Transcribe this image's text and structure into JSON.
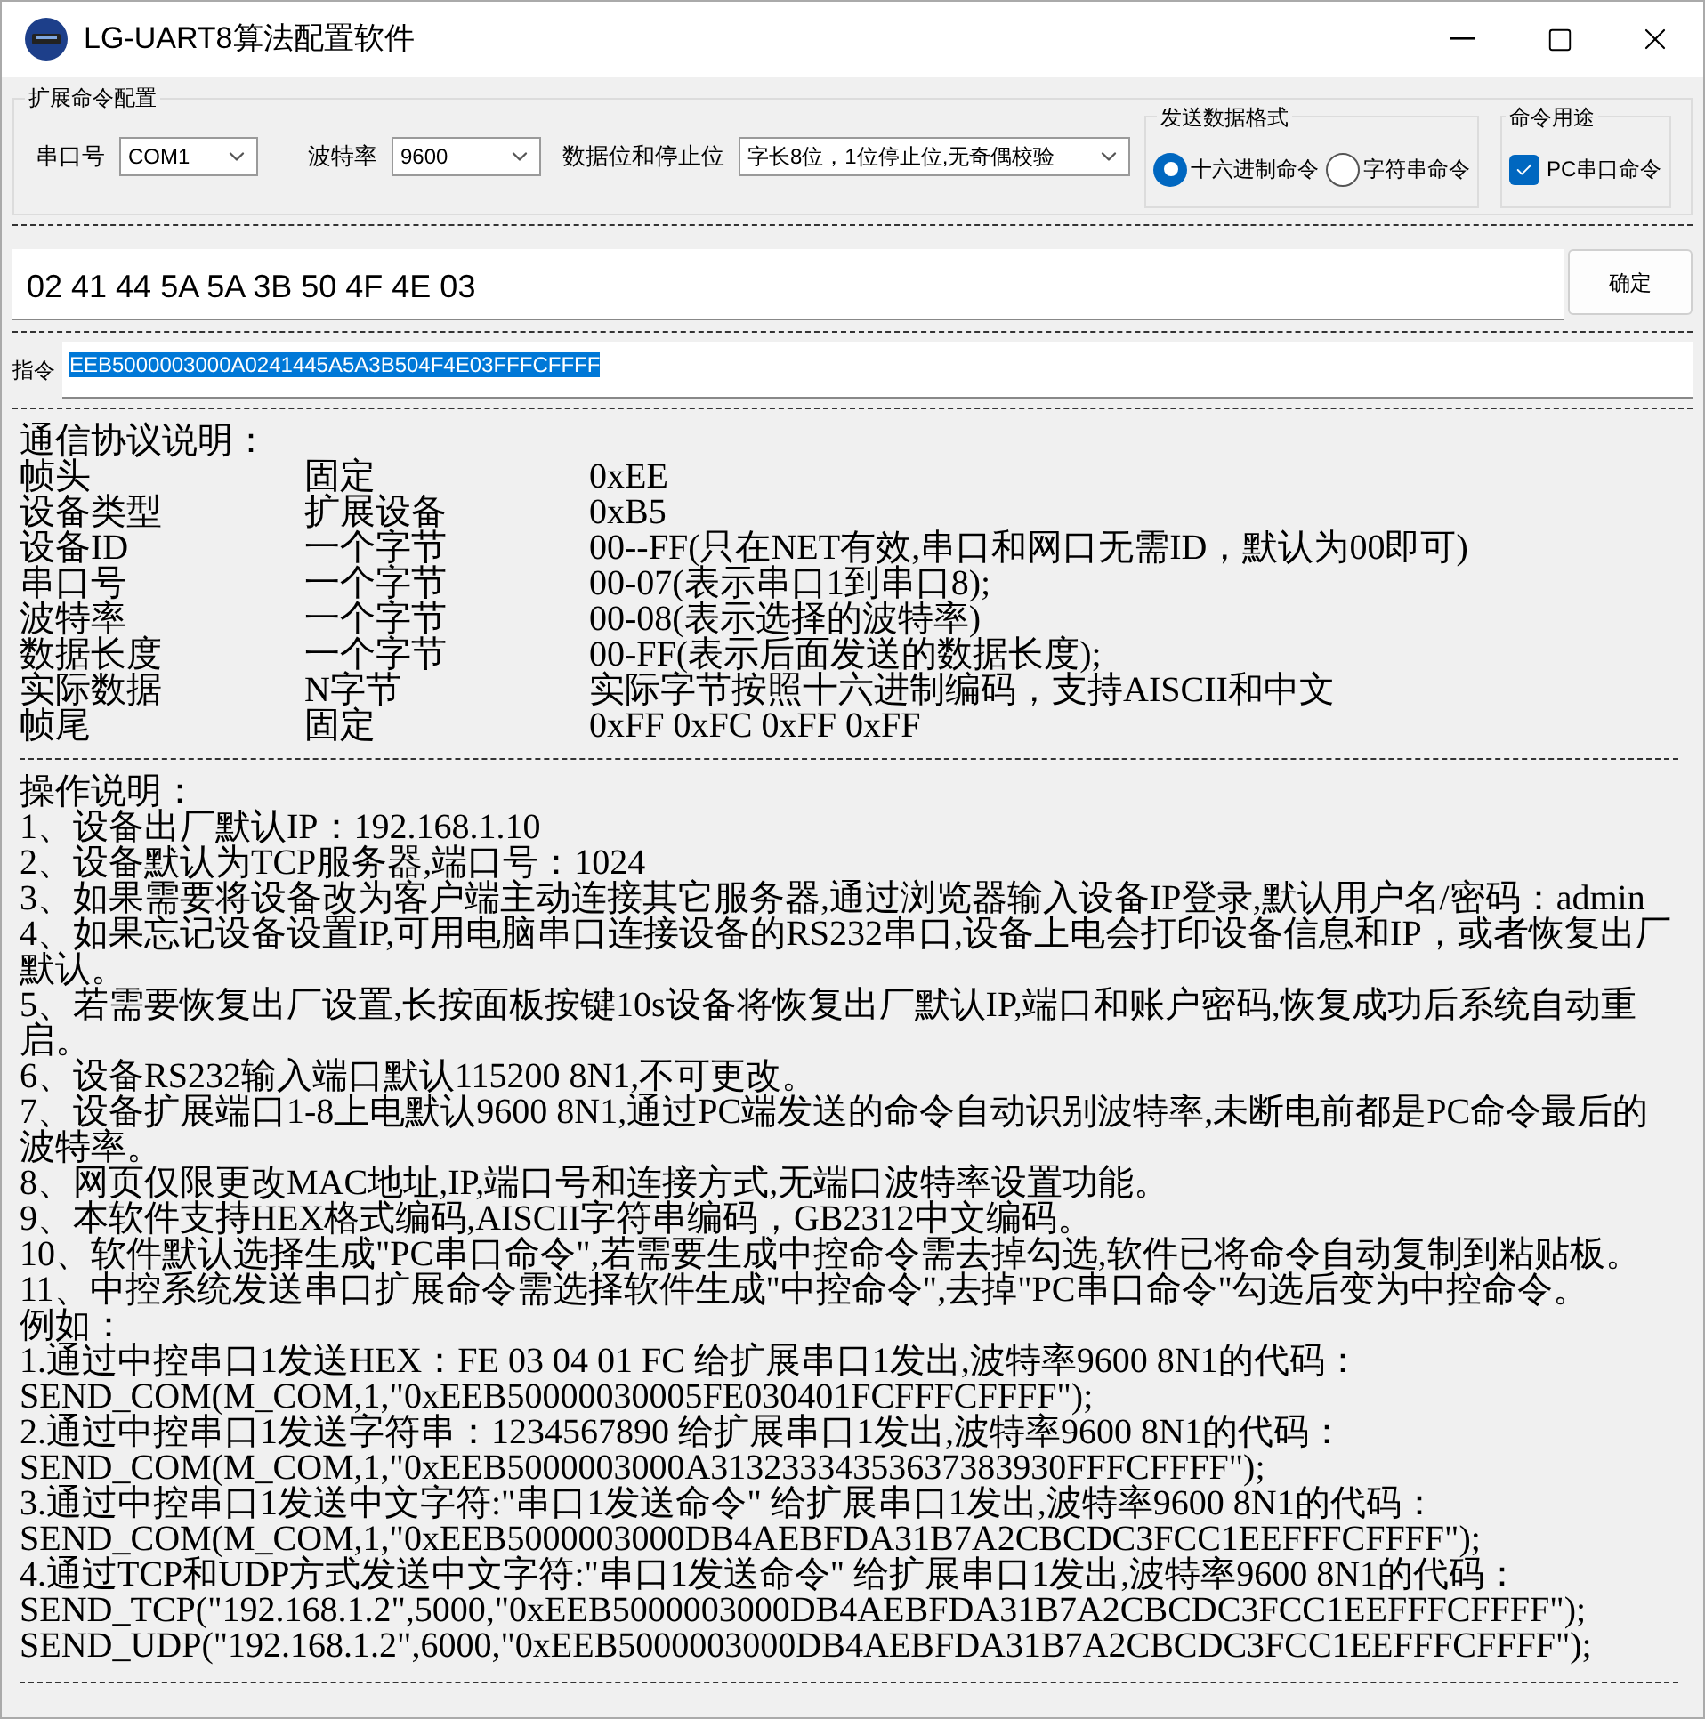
{
  "window": {
    "title": "LG-UART8算法配置软件"
  },
  "config": {
    "title": "扩展命令配置",
    "port": {
      "label": "串口号",
      "value": "COM1"
    },
    "baud": {
      "label": "波特率",
      "value": "9600"
    },
    "data_bits": {
      "label": "数据位和停止位",
      "value": "字长8位，1位停止位,无奇偶校验"
    },
    "format": {
      "title": "发送数据格式",
      "options": [
        {
          "label": "十六进制命令",
          "selected": true
        },
        {
          "label": "字符串命令",
          "selected": false
        }
      ]
    },
    "usage": {
      "title": "命令用途",
      "checkbox": {
        "label": "PC串口命令",
        "checked": true
      }
    }
  },
  "input": {
    "value": "02 41 44 5A 5A 3B 50 4F 4E 03",
    "button": "确定"
  },
  "command": {
    "label": "指令",
    "value": "EEB5000003000A0241445A5A3B504F4E03FFFCFFFF",
    "selected": true
  },
  "protocol": {
    "title": "通信协议说明：",
    "rows": [
      {
        "field": "帧头",
        "size": "固定",
        "value": "0xEE"
      },
      {
        "field": "设备类型",
        "size": "扩展设备",
        "value": "0xB5"
      },
      {
        "field": "设备ID",
        "size": "一个字节",
        "value": "00--FF(只在NET有效,串口和网口无需ID，默认为00即可)"
      },
      {
        "field": "串口号",
        "size": "一个字节",
        "value": "00-07(表示串口1到串口8);"
      },
      {
        "field": "波特率",
        "size": "一个字节",
        "value": "00-08(表示选择的波特率)"
      },
      {
        "field": "数据长度",
        "size": "一个字节",
        "value": "00-FF(表示后面发送的数据长度);"
      },
      {
        "field": "实际数据",
        "size": "N字节",
        "value": "实际字节按照十六进制编码，支持AISCII和中文"
      },
      {
        "field": "帧尾",
        "size": "固定",
        "value": "0xFF 0xFC 0xFF 0xFF"
      }
    ]
  },
  "instructions": {
    "title": "操作说明：",
    "items": [
      "1、设备出厂默认IP：192.168.1.10",
      "2、设备默认为TCP服务器,端口号：1024",
      "3、如果需要将设备改为客户端主动连接其它服务器,通过浏览器输入设备IP登录,默认用户名/密码：admin",
      "4、如果忘记设备设置IP,可用电脑串口连接设备的RS232串口,设备上电会打印设备信息和IP，或者恢复出厂默认。",
      "5、若需要恢复出厂设置,长按面板按键10s设备将恢复出厂默认IP,端口和账户密码,恢复成功后系统自动重启。",
      "6、设备RS232输入端口默认115200 8N1,不可更改。",
      "7、设备扩展端口1-8上电默认9600 8N1,通过PC端发送的命令自动识别波特率,未断电前都是PC命令最后的波特率。",
      "8、网页仅限更改MAC地址,IP,端口号和连接方式,无端口波特率设置功能。",
      "9、本软件支持HEX格式编码,AISCII字符串编码，GB2312中文编码。",
      "10、软件默认选择生成\"PC串口命令\",若需要生成中控命令需去掉勾选,软件已将命令自动复制到粘贴板。",
      "11、中控系统发送串口扩展命令需选择软件生成\"中控命令\",去掉\"PC串口命令\"勾选后变为中控命令。"
    ],
    "example_title": "例如：",
    "examples": [
      "1.通过中控串口1发送HEX：FE 03 04 01 FC 给扩展串口1发出,波特率9600 8N1的代码：",
      "SEND_COM(M_COM,1,\"0xEEB50000030005FE030401FCFFFCFFFF\");",
      "2.通过中控串口1发送字符串：1234567890 给扩展串口1发出,波特率9600 8N1的代码：",
      "SEND_COM(M_COM,1,\"0xEEB5000003000A31323334353637383930FFFCFFFF\");",
      "3.通过中控串口1发送中文字符:\"串口1发送命令\" 给扩展串口1发出,波特率9600 8N1的代码：",
      "SEND_COM(M_COM,1,\"0xEEB5000003000DB4AEBFDA31B7A2CBCDC3FCC1EEFFFCFFFF\");",
      "4.通过TCP和UDP方式发送中文字符:\"串口1发送命令\" 给扩展串口1发出,波特率9600 8N1的代码：",
      "SEND_TCP(\"192.168.1.2\",5000,\"0xEEB5000003000DB4AEBFDA31B7A2CBCDC3FCC1EEFFFCFFFF\");",
      "SEND_UDP(\"192.168.1.2\",6000,\"0xEEB5000003000DB4AEBFDA31B7A2CBCDC3FCC1EEFFFCFFFF\");"
    ]
  }
}
